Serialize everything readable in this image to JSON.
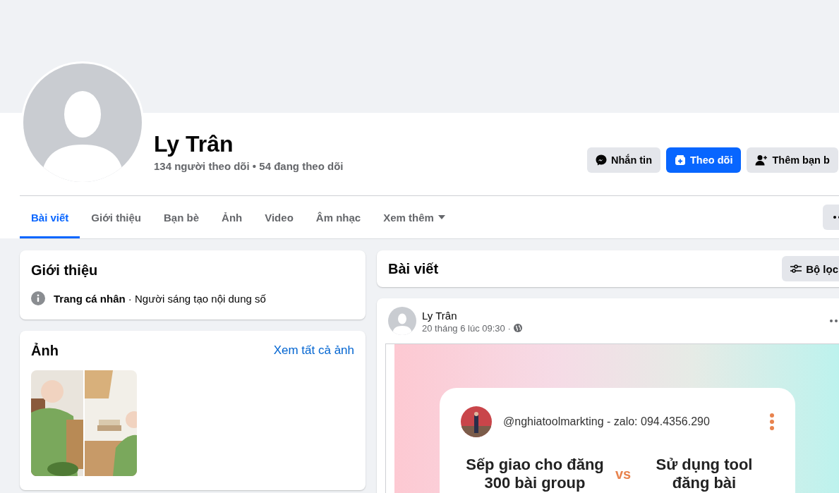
{
  "profile": {
    "name": "Ly Trân",
    "stats": "134 người theo dõi • 54 đang theo dõi"
  },
  "actions": [
    {
      "label": "Nhắn tin",
      "kind": "message"
    },
    {
      "label": "Theo dõi",
      "kind": "follow"
    },
    {
      "label": "Thêm bạn b",
      "kind": "friend"
    }
  ],
  "tabs": [
    {
      "label": "Bài viết",
      "selected": true
    },
    {
      "label": "Giới thiệu",
      "selected": false
    },
    {
      "label": "Bạn bè",
      "selected": false
    },
    {
      "label": "Ảnh",
      "selected": false
    },
    {
      "label": "Video",
      "selected": false
    },
    {
      "label": "Âm nhạc",
      "selected": false
    },
    {
      "label": "Xem thêm",
      "selected": false,
      "dropdown": true
    }
  ],
  "intro": {
    "title": "Giới thiệu",
    "details": "**Trang cá nhân** · Người sáng tạo nội dung số"
  },
  "photos": {
    "title": "Ảnh",
    "link": "Xem tất cả ảnh"
  },
  "posts_header": {
    "title": "Bài viết",
    "filter": "Bộ lọc"
  },
  "post": {
    "author": "Ly Trân",
    "time": "20 tháng 6 lúc 09:30 ·",
    "image": {
      "handle": "@nghiatoolmarkting - zalo: 094.4356.290",
      "left": "Sếp giao cho đăng 300 bài group",
      "vs": "vs",
      "right": "Sử dụng tool đăng bài"
    }
  }
}
